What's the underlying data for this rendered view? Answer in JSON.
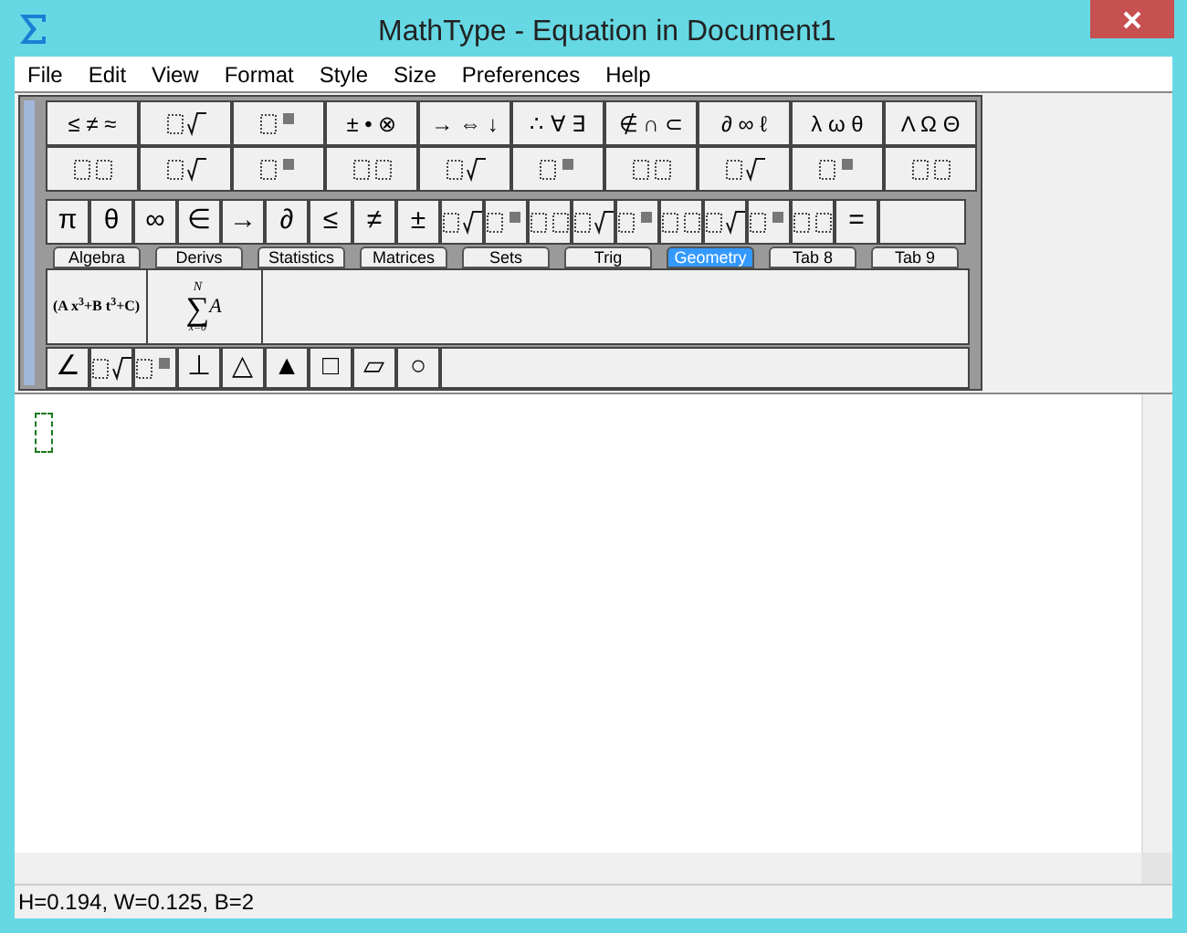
{
  "window": {
    "title": "MathType - Equation in Document1"
  },
  "menu": [
    "File",
    "Edit",
    "View",
    "Format",
    "Style",
    "Size",
    "Preferences",
    "Help"
  ],
  "symbol_row": [
    {
      "kind": "text",
      "label": "≤ ≠ ≈"
    },
    {
      "kind": "icon"
    },
    {
      "kind": "icon"
    },
    {
      "kind": "text",
      "label": "± • ⊗"
    },
    {
      "kind": "text",
      "label": "→ ⇔ ↓"
    },
    {
      "kind": "text",
      "label": "∴ ∀ ∃"
    },
    {
      "kind": "text",
      "label": "∉ ∩ ⊂"
    },
    {
      "kind": "text",
      "label": "∂ ∞ ℓ"
    },
    {
      "kind": "text",
      "label": "λ ω θ"
    },
    {
      "kind": "text",
      "label": "Λ Ω Θ"
    }
  ],
  "template_row": [
    {
      "kind": "icon"
    },
    {
      "kind": "icon"
    },
    {
      "kind": "icon"
    },
    {
      "kind": "icon"
    },
    {
      "kind": "icon"
    },
    {
      "kind": "icon"
    },
    {
      "kind": "icon"
    },
    {
      "kind": "icon"
    },
    {
      "kind": "icon"
    },
    {
      "kind": "icon"
    }
  ],
  "small_row": [
    {
      "kind": "text",
      "label": "π"
    },
    {
      "kind": "text",
      "label": "θ"
    },
    {
      "kind": "text",
      "label": "∞"
    },
    {
      "kind": "text",
      "label": "∈"
    },
    {
      "kind": "text",
      "label": "→"
    },
    {
      "kind": "text",
      "label": "∂"
    },
    {
      "kind": "text",
      "label": "≤"
    },
    {
      "kind": "text",
      "label": "≠"
    },
    {
      "kind": "text",
      "label": "±"
    },
    {
      "kind": "icon"
    },
    {
      "kind": "icon"
    },
    {
      "kind": "icon"
    },
    {
      "kind": "icon"
    },
    {
      "kind": "icon"
    },
    {
      "kind": "icon"
    },
    {
      "kind": "icon"
    },
    {
      "kind": "icon"
    },
    {
      "kind": "icon"
    },
    {
      "kind": "text",
      "label": "="
    }
  ],
  "tabs": [
    {
      "label": "Algebra",
      "selected": false
    },
    {
      "label": "Derivs",
      "selected": false
    },
    {
      "label": "Statistics",
      "selected": false
    },
    {
      "label": "Matrices",
      "selected": false
    },
    {
      "label": "Sets",
      "selected": false
    },
    {
      "label": "Trig",
      "selected": false
    },
    {
      "label": "Geometry",
      "selected": true
    },
    {
      "label": "Tab 8",
      "selected": false
    },
    {
      "label": "Tab 9",
      "selected": false
    }
  ],
  "expressions": [
    {
      "kind": "formula",
      "text": "(A x$^{3}$+B t$^{3}$+C)"
    },
    {
      "kind": "sum",
      "upper": "N",
      "operator": "∑",
      "body": "A",
      "lower": "x=0"
    }
  ],
  "geometry_row": [
    {
      "kind": "text",
      "label": "∠"
    },
    {
      "kind": "icon"
    },
    {
      "kind": "icon"
    },
    {
      "kind": "text",
      "label": "⊥"
    },
    {
      "kind": "text",
      "label": "△"
    },
    {
      "kind": "text",
      "label": "▲"
    },
    {
      "kind": "text",
      "label": "□"
    },
    {
      "kind": "text",
      "label": "▱"
    },
    {
      "kind": "text",
      "label": "○"
    }
  ],
  "status_bar": "H=0.194, W=0.125, B=2"
}
